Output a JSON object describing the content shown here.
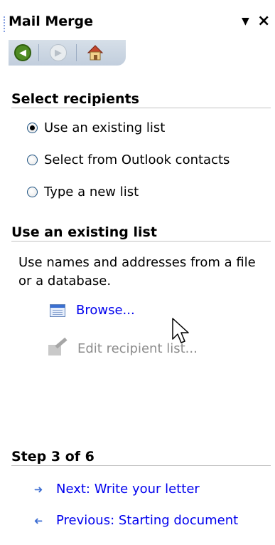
{
  "pane": {
    "title": "Mail Merge",
    "dropdown_glyph": "▼",
    "close_glyph": "×"
  },
  "nav": {
    "back_icon": "back-arrow-icon",
    "forward_icon": "forward-arrow-icon",
    "home_icon": "home-icon"
  },
  "select_recipients": {
    "heading": "Select recipients",
    "options": [
      {
        "label": "Use an existing list",
        "selected": true
      },
      {
        "label": "Select from Outlook contacts",
        "selected": false
      },
      {
        "label": "Type a new list",
        "selected": false
      }
    ]
  },
  "existing_list": {
    "heading": "Use an existing list",
    "description": "Use names and addresses from a file or a database.",
    "browse_label": "Browse...",
    "edit_label": "Edit recipient list..."
  },
  "step": {
    "heading": "Step 3 of 6",
    "next_label": "Next: Write your letter",
    "previous_label": "Previous: Starting document"
  },
  "colors": {
    "link": "#0000ee",
    "disabled": "#8c8c8c",
    "nav_bar": "#c9d3df",
    "back_button": "#4e8b23"
  }
}
